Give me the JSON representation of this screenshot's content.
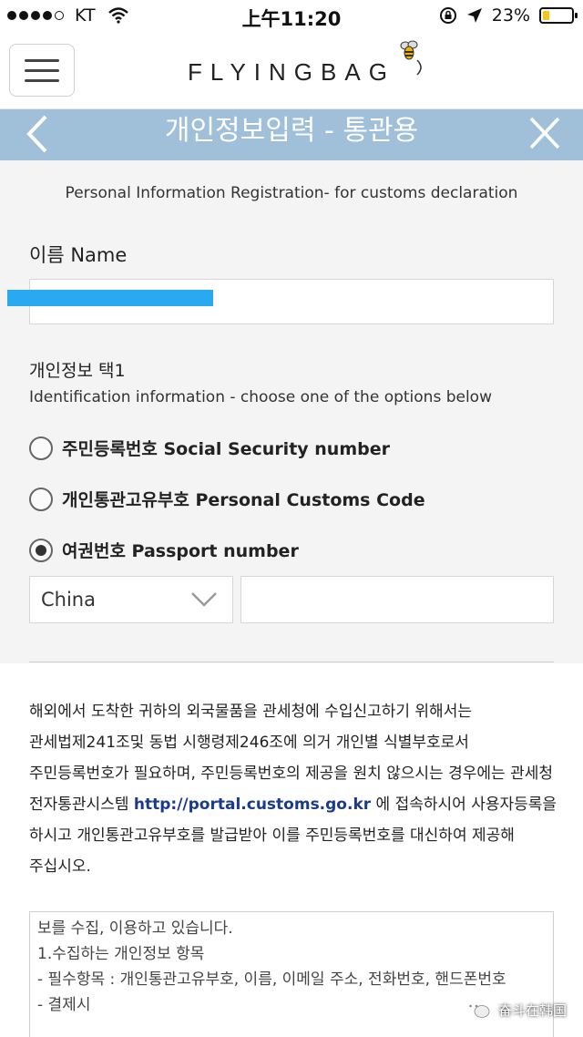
{
  "status_bar": {
    "carrier": "KT",
    "time": "上午11:20",
    "battery": "23%",
    "battery_level": 0.23
  },
  "header": {
    "logo": "FLYINGBAG"
  },
  "title_bar": {
    "title": "개인정보입력 - 통관용"
  },
  "form": {
    "subtitle": "Personal Information Registration- for customs declaration",
    "name_label": "이름 Name",
    "name_value": "",
    "id_label": "개인정보 택1",
    "id_description": "Identification information - choose one of the options below",
    "options": [
      {
        "label": "주민등록번호 Social Security number",
        "checked": false
      },
      {
        "label": "개인통관고유부호 Personal Customs Code",
        "checked": false
      },
      {
        "label": "여권번호 Passport number",
        "checked": true
      }
    ],
    "country_value": "China",
    "passport_value": ""
  },
  "notice": {
    "text_before": "해외에서 도착한 귀하의 외국물품을 관세청에 수입신고하기 위해서는 관세법제241조및 동법 시행령제246조에 의거 개인별 식별부호로서 주민등록번호가 필요하며, 주민등록번호의 제공을 원치 않으시는 경우에는 관세청 전자통관시스템 ",
    "link": "http://portal.customs.go.kr",
    "text_after": " 에 접속하시어 사용자등록을 하시고 개인통관고유부호를 발급받아 이를 주민등록번호를 대신하여 제공해 주십시오."
  },
  "terms": {
    "lines": [
      "보를 수집, 이용하고 있습니다.",
      "1.수집하는 개인정보 항목",
      "- 필수항목 : 개인통관고유부호, 이름, 이메일 주소, 전화번호, 핸드폰번호",
      "- 결제시"
    ]
  },
  "watermark_badge": {
    "text": "奋斗在韩国"
  },
  "colors": {
    "title_bar": "#9fc0d8",
    "form_bg": "#f4f4f4",
    "redaction": "#29a9f0",
    "link": "#1a3a8a"
  }
}
